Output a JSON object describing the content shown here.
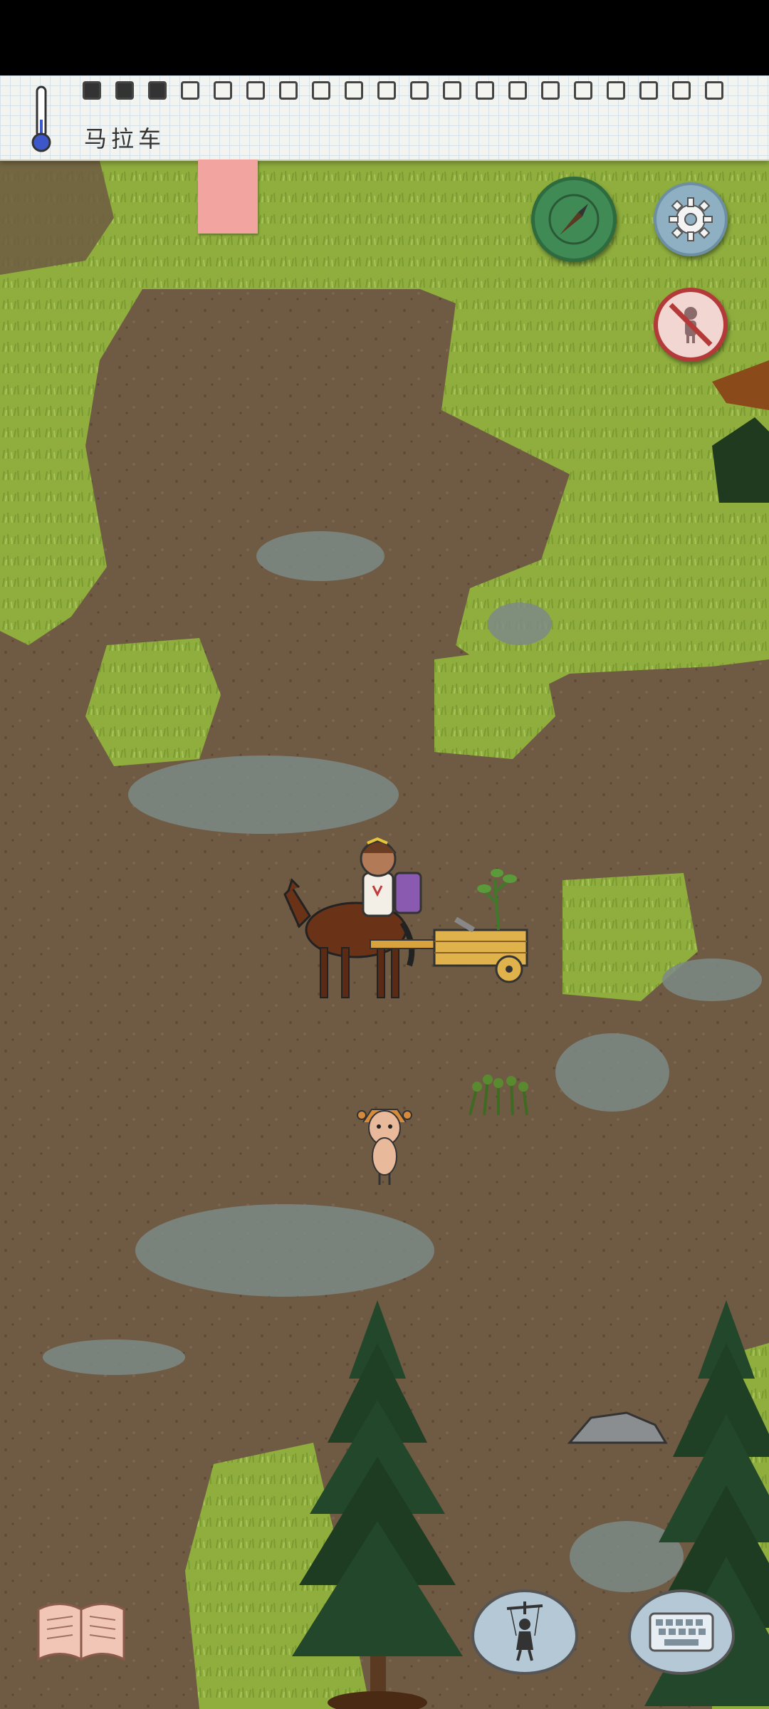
{
  "hud": {
    "held_object_label": "马拉车",
    "food_meter": {
      "filled": 3,
      "total": 20
    }
  },
  "icons": {
    "thermometer": "thermometer-icon",
    "compass": "compass-icon",
    "settings": "gear-icon",
    "no_profile": "no-person-icon",
    "book": "open-book-icon",
    "puppet": "puppet-icon",
    "keyboard": "keyboard-icon"
  },
  "colors": {
    "compass_bg": "#3f8a55",
    "settings_bg": "#8fb0c3",
    "no_profile_ring": "#b43a3a",
    "grass": "#8fae3e",
    "dirt": "#6f5a43"
  }
}
